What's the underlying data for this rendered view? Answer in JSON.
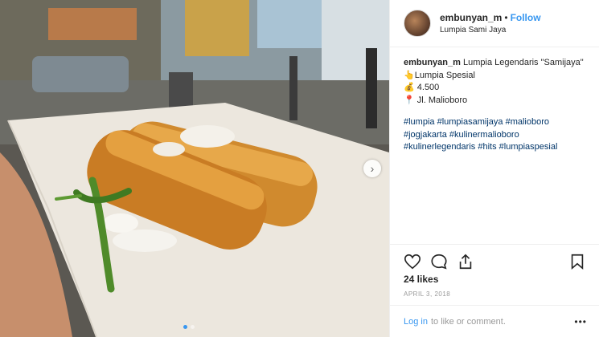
{
  "header": {
    "username": "embunyan_m",
    "separator": "•",
    "follow_label": "Follow",
    "location": "Lumpia Sami Jaya"
  },
  "caption": {
    "username": "embunyan_m",
    "text": "Lumpia Legendaris \"Samijaya\"",
    "lines": [
      {
        "icon": "👆",
        "text": "Lumpia Spesial"
      },
      {
        "icon": "💰",
        "text": "4.500"
      },
      {
        "icon": "📍",
        "text": "Jl. Malioboro"
      }
    ]
  },
  "hashtags": [
    "#lumpia",
    "#lumpiasamijaya",
    "#malioboro",
    "#jogjakarta",
    "#kulinermalioboro",
    "#kulinerlegendaris",
    "#hits",
    "#lumpiaspesial"
  ],
  "likes": "24 likes",
  "date": "APRIL 3, 2018",
  "comment": {
    "login_label": "Log in",
    "suffix": "to like or comment."
  },
  "more_label": "•••",
  "next_icon": "›",
  "carousel": {
    "count": 2,
    "active": 1
  },
  "colors": {
    "link": "#003569",
    "accent": "#3897f0",
    "muted": "#999999"
  }
}
